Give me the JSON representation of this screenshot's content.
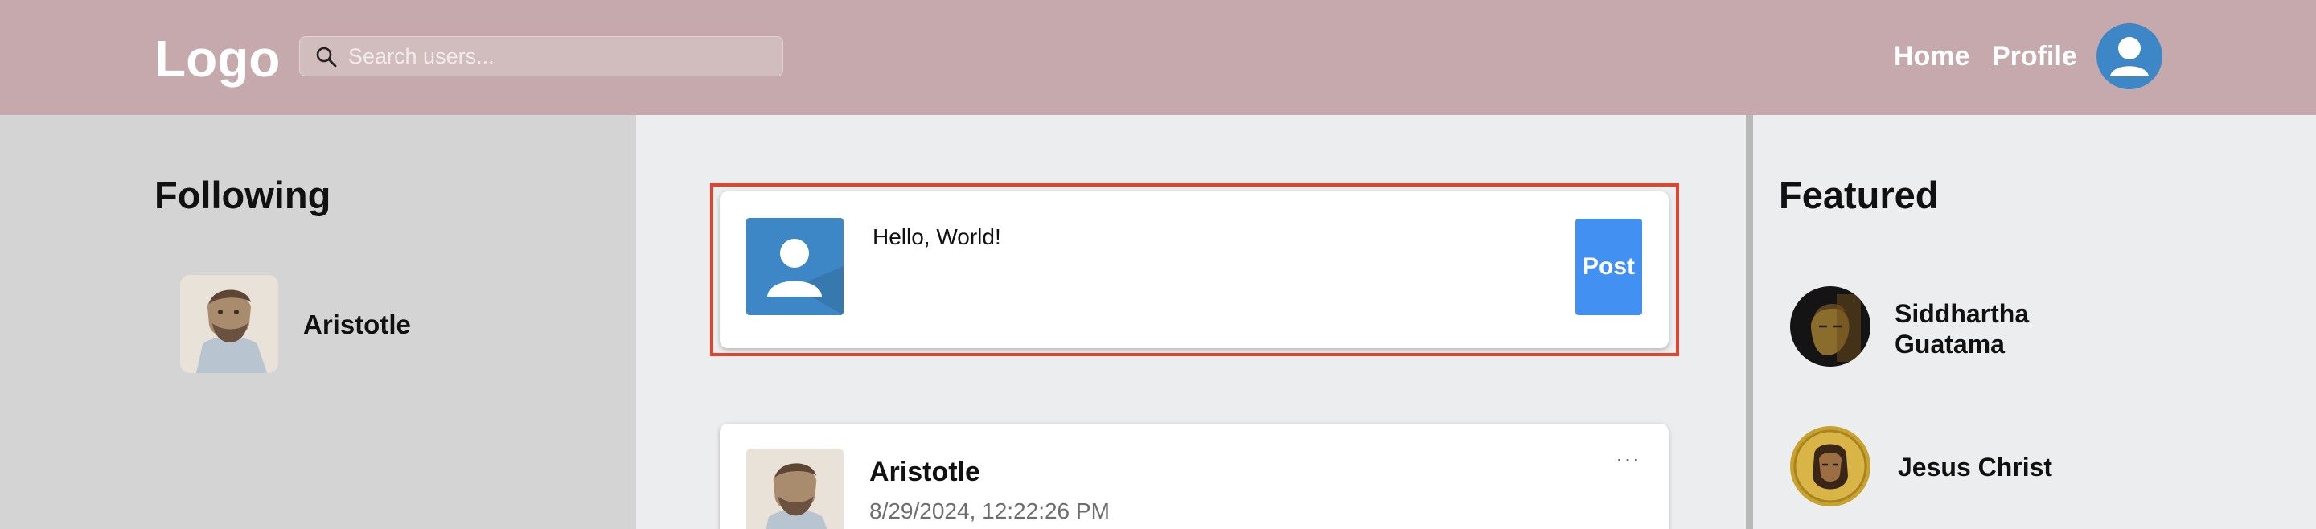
{
  "header": {
    "logo": "Logo",
    "search_placeholder": "Search users...",
    "nav": {
      "home": "Home",
      "profile": "Profile"
    }
  },
  "following": {
    "title": "Following",
    "items": [
      {
        "name": "Aristotle"
      }
    ]
  },
  "composer": {
    "text": "Hello, World!",
    "post_label": "Post"
  },
  "feed": {
    "posts": [
      {
        "author": "Aristotle",
        "timestamp": "8/29/2024, 12:22:26 PM",
        "menu": "···"
      }
    ]
  },
  "featured": {
    "title": "Featured",
    "items": [
      {
        "name": "Siddhartha Guatama"
      },
      {
        "name": "Jesus Christ"
      }
    ]
  },
  "colors": {
    "header_bg": "#c5a9ac",
    "left_bg": "#d4d4d4",
    "main_bg": "#ecedef",
    "accent": "#4190f2",
    "avatar_blue": "#3d87c7",
    "highlight": "#e2452e"
  }
}
